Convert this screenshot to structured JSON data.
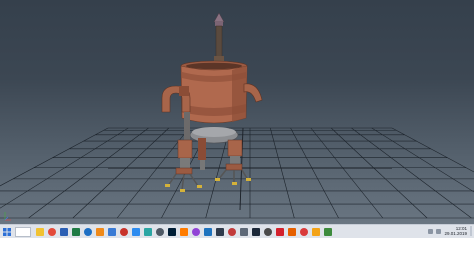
{
  "viewport": {
    "background_top": "#35404c",
    "background_bottom": "#6a7682",
    "grid_color": "#1c232b",
    "axis_colors": {
      "x": "#d04848",
      "y": "#4ca04c"
    }
  },
  "taskbar": {
    "start_icon": "windows-icon",
    "search_icon": "search-field",
    "apps": [
      {
        "name": "file-explorer-icon",
        "color": "#f1c232"
      },
      {
        "name": "chrome-icon",
        "color": "#e34a3a"
      },
      {
        "name": "word-icon",
        "color": "#2b5fb4"
      },
      {
        "name": "excel-icon",
        "color": "#1f7b45"
      },
      {
        "name": "outlook-icon",
        "color": "#1c6fc4"
      },
      {
        "name": "vlc-icon",
        "color": "#ef8a1a"
      },
      {
        "name": "photos-icon",
        "color": "#3a7bd5"
      },
      {
        "name": "acrobat-icon",
        "color": "#c8332b"
      },
      {
        "name": "chat-icon",
        "color": "#2d8cf0"
      },
      {
        "name": "maya-icon",
        "color": "#2ba6a4"
      },
      {
        "name": "store-icon",
        "color": "#4f5a66"
      },
      {
        "name": "ps-icon",
        "color": "#001e36"
      },
      {
        "name": "ai-icon",
        "color": "#ff7c00"
      },
      {
        "name": "media-icon",
        "color": "#9143d6"
      },
      {
        "name": "mail-icon",
        "color": "#1e73be"
      },
      {
        "name": "video-icon",
        "color": "#2f3b4c"
      },
      {
        "name": "game-icon",
        "color": "#c23b3b"
      },
      {
        "name": "settings-icon",
        "color": "#5d6877"
      },
      {
        "name": "steam-icon",
        "color": "#1b2838"
      },
      {
        "name": "app-icon-20",
        "color": "#4a4a4a"
      },
      {
        "name": "opera-icon",
        "color": "#d3212c"
      },
      {
        "name": "firefox-icon",
        "color": "#e66000"
      },
      {
        "name": "app-icon-23",
        "color": "#d93a3a"
      },
      {
        "name": "app-icon-24",
        "color": "#f3a317"
      },
      {
        "name": "app-icon-25",
        "color": "#3d8b3d"
      }
    ],
    "clock": {
      "time": "12:01",
      "date": "29.01.2019"
    }
  }
}
